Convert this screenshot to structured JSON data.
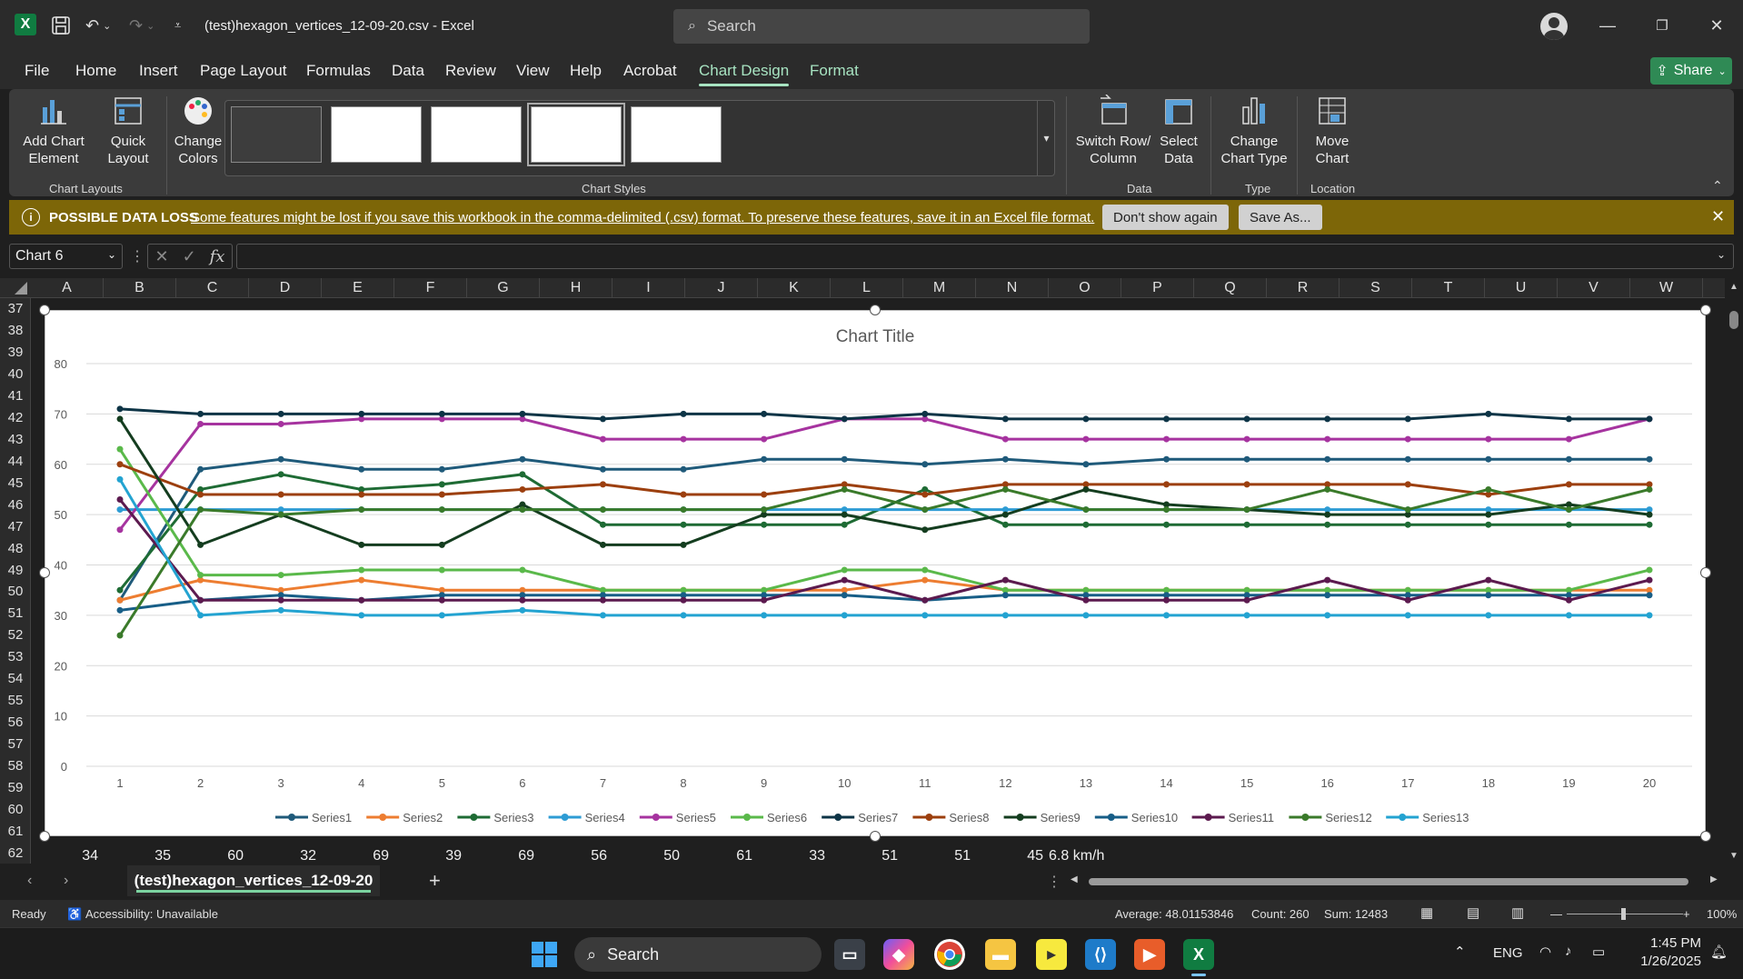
{
  "titlebar": {
    "logo": "X",
    "doc_title": "(test)hexagon_vertices_12-09-20.csv  -  Excel",
    "search_placeholder": "Search"
  },
  "menu": {
    "tabs": [
      "File",
      "Home",
      "Insert",
      "Page Layout",
      "Formulas",
      "Data",
      "Review",
      "View",
      "Help",
      "Acrobat",
      "Chart Design",
      "Format"
    ],
    "active": "Chart Design",
    "share": "Share"
  },
  "ribbon": {
    "add_chart_element": "Add Chart Element",
    "quick_layout": "Quick Layout",
    "chart_layouts": "Chart Layouts",
    "change_colors": "Change Colors",
    "chart_styles": "Chart Styles",
    "switch_row_column": "Switch Row/ Column",
    "select_data": "Select Data",
    "data_group": "Data",
    "change_chart_type": "Change Chart Type",
    "type_group": "Type",
    "move_chart": "Move Chart",
    "location_group": "Location"
  },
  "warning": {
    "title": "POSSIBLE DATA LOSS",
    "message": "Some features might be lost if you save this workbook in the comma-delimited (.csv) format. To preserve these features, save it in an Excel file format.",
    "dont_show": "Don't show again",
    "save_as": "Save As..."
  },
  "formula_bar": {
    "name_box": "Chart 6",
    "fx": "fx"
  },
  "columns": [
    "A",
    "B",
    "C",
    "D",
    "E",
    "F",
    "G",
    "H",
    "I",
    "J",
    "K",
    "L",
    "M",
    "N",
    "O",
    "P",
    "Q",
    "R",
    "S",
    "T",
    "U",
    "V",
    "W"
  ],
  "rows": [
    "37",
    "38",
    "39",
    "40",
    "41",
    "42",
    "43",
    "44",
    "45",
    "46",
    "47",
    "48",
    "49",
    "50",
    "51",
    "52",
    "53",
    "54",
    "55",
    "56",
    "57",
    "58",
    "59",
    "60",
    "61",
    "62"
  ],
  "row62_values": [
    "34",
    "35",
    "60",
    "32",
    "69",
    "39",
    "69",
    "56",
    "50",
    "61",
    "33",
    "51",
    "51",
    "45",
    "6.8 km/h"
  ],
  "chart_data": {
    "type": "line",
    "title": "Chart Title",
    "xlabel": "",
    "ylabel": "",
    "ylim": [
      0,
      80
    ],
    "yticks": [
      0,
      10,
      20,
      30,
      40,
      50,
      60,
      70,
      80
    ],
    "categories": [
      1,
      2,
      3,
      4,
      5,
      6,
      7,
      8,
      9,
      10,
      11,
      12,
      13,
      14,
      15,
      16,
      17,
      18,
      19,
      20
    ],
    "grid": true,
    "legend": "bottom",
    "series": [
      {
        "name": "Series1",
        "color": "#1f5a7a",
        "values": [
          33,
          59,
          61,
          59,
          59,
          61,
          59,
          59,
          61,
          61,
          60,
          61,
          60,
          61,
          61,
          61,
          61,
          61,
          61,
          61
        ]
      },
      {
        "name": "Series2",
        "color": "#ed7d31",
        "values": [
          33,
          37,
          35,
          37,
          35,
          35,
          35,
          35,
          35,
          35,
          37,
          35,
          35,
          35,
          35,
          35,
          35,
          35,
          35,
          35
        ]
      },
      {
        "name": "Series3",
        "color": "#1e6b34",
        "values": [
          35,
          55,
          58,
          55,
          56,
          58,
          48,
          48,
          48,
          48,
          55,
          48,
          48,
          48,
          48,
          48,
          48,
          48,
          48,
          48
        ]
      },
      {
        "name": "Series4",
        "color": "#2e9cd4",
        "values": [
          51,
          51,
          51,
          51,
          51,
          51,
          51,
          51,
          51,
          51,
          51,
          51,
          51,
          51,
          51,
          51,
          51,
          51,
          51,
          51
        ]
      },
      {
        "name": "Series5",
        "color": "#a6339f",
        "values": [
          47,
          68,
          68,
          69,
          69,
          69,
          65,
          65,
          65,
          69,
          69,
          65,
          65,
          65,
          65,
          65,
          65,
          65,
          65,
          69
        ]
      },
      {
        "name": "Series6",
        "color": "#5ab94a",
        "values": [
          63,
          38,
          38,
          39,
          39,
          39,
          35,
          35,
          35,
          39,
          39,
          35,
          35,
          35,
          35,
          35,
          35,
          35,
          35,
          39
        ]
      },
      {
        "name": "Series7",
        "color": "#0d3446",
        "values": [
          71,
          70,
          70,
          70,
          70,
          70,
          69,
          70,
          70,
          69,
          70,
          69,
          69,
          69,
          69,
          69,
          69,
          70,
          69,
          69
        ]
      },
      {
        "name": "Series8",
        "color": "#9c3f0e",
        "values": [
          60,
          54,
          54,
          54,
          54,
          55,
          56,
          54,
          54,
          56,
          54,
          56,
          56,
          56,
          56,
          56,
          56,
          54,
          56,
          56
        ]
      },
      {
        "name": "Series9",
        "color": "#143d1f",
        "values": [
          69,
          44,
          50,
          44,
          44,
          52,
          44,
          44,
          50,
          50,
          47,
          50,
          55,
          52,
          51,
          50,
          50,
          50,
          52,
          50
        ]
      },
      {
        "name": "Series10",
        "color": "#175e87",
        "values": [
          31,
          33,
          34,
          33,
          34,
          34,
          34,
          34,
          34,
          34,
          33,
          34,
          34,
          34,
          34,
          34,
          34,
          34,
          34,
          34
        ]
      },
      {
        "name": "Series11",
        "color": "#5c1a4f",
        "values": [
          53,
          33,
          33,
          33,
          33,
          33,
          33,
          33,
          33,
          37,
          33,
          37,
          33,
          33,
          33,
          37,
          33,
          37,
          33,
          37
        ]
      },
      {
        "name": "Series12",
        "color": "#3a7a2a",
        "values": [
          26,
          51,
          50,
          51,
          51,
          51,
          51,
          51,
          51,
          55,
          51,
          55,
          51,
          51,
          51,
          55,
          51,
          55,
          51,
          55
        ]
      },
      {
        "name": "Series13",
        "color": "#23a3d1",
        "values": [
          57,
          30,
          31,
          30,
          30,
          31,
          30,
          30,
          30,
          30,
          30,
          30,
          30,
          30,
          30,
          30,
          30,
          30,
          30,
          30
        ]
      }
    ]
  },
  "sheet": {
    "tab_name": "(test)hexagon_vertices_12-09-20",
    "add": "+"
  },
  "status": {
    "ready": "Ready",
    "accessibility": "Accessibility: Unavailable",
    "average": "Average: 48.01153846",
    "count": "Count: 260",
    "sum": "Sum: 12483",
    "zoom": "100%"
  },
  "taskbar": {
    "search": "Search",
    "lang": "ENG",
    "time": "1:45 PM",
    "date": "1/26/2025"
  }
}
